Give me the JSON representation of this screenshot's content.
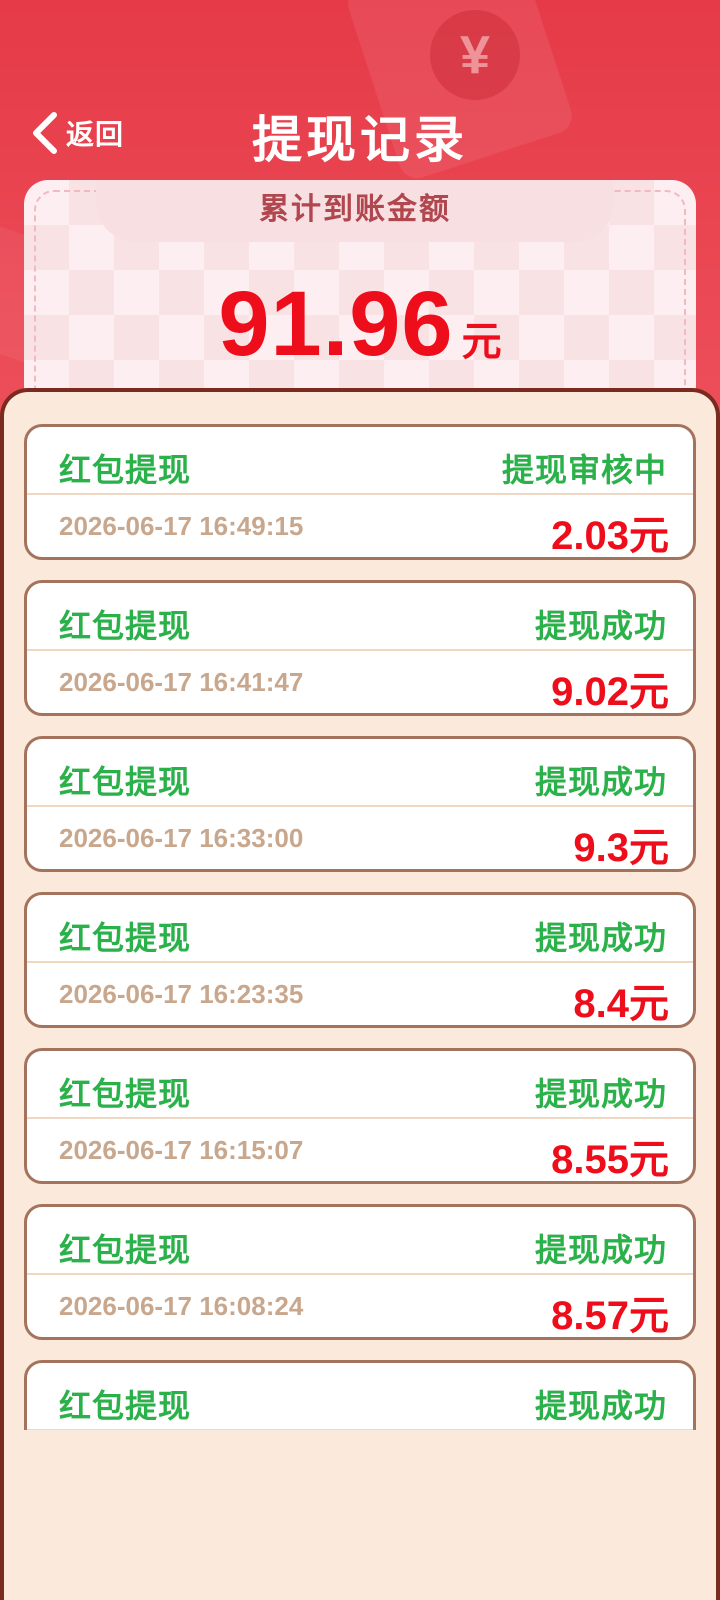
{
  "header": {
    "back_label": "返回",
    "title": "提现记录"
  },
  "summary": {
    "label": "累计到账金额",
    "amount": "91.96",
    "unit": "元"
  },
  "records": [
    {
      "title": "红包提现",
      "status": "提现审核中",
      "time": "2026-06-17 16:49:15",
      "amount": "2.03元"
    },
    {
      "title": "红包提现",
      "status": "提现成功",
      "time": "2026-06-17 16:41:47",
      "amount": "9.02元"
    },
    {
      "title": "红包提现",
      "status": "提现成功",
      "time": "2026-06-17 16:33:00",
      "amount": "9.3元"
    },
    {
      "title": "红包提现",
      "status": "提现成功",
      "time": "2026-06-17 16:23:35",
      "amount": "8.4元"
    },
    {
      "title": "红包提现",
      "status": "提现成功",
      "time": "2026-06-17 16:15:07",
      "amount": "8.55元"
    },
    {
      "title": "红包提现",
      "status": "提现成功",
      "time": "2026-06-17 16:08:24",
      "amount": "8.57元"
    },
    {
      "title": "红包提现",
      "status": "提现成功",
      "time": "",
      "amount": ""
    }
  ],
  "colors": {
    "header_red": "#e63a48",
    "status_green": "#2bb14a",
    "amount_red": "#ee0d1a",
    "panel_bg": "#fbeadb"
  }
}
